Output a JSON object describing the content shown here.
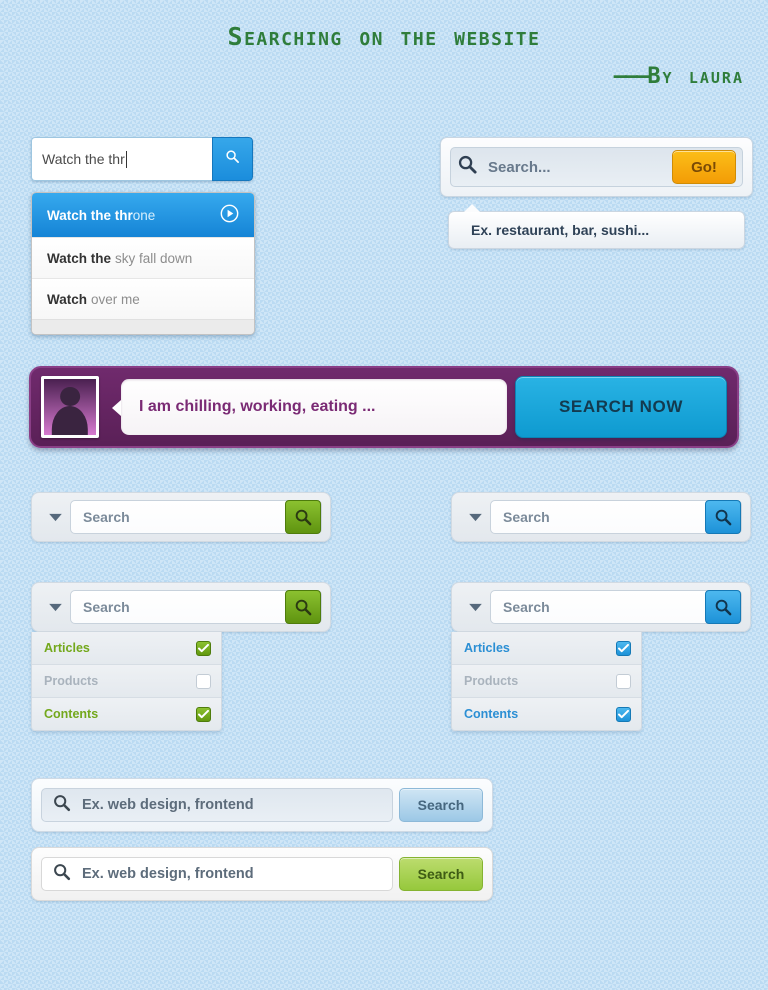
{
  "header": {
    "title": "Searching on the website",
    "byline_dash": "———",
    "byline": "By laura",
    "title_color": "#2f7d3b"
  },
  "autocomplete": {
    "input_value": "Watch the thr",
    "search_icon": "magnifier-icon",
    "suggestions": [
      {
        "bold": "Watch the thr",
        "rest": "one",
        "active": true,
        "icon": "play-circle-icon"
      },
      {
        "bold": "Watch the",
        "rest": "sky fall down",
        "active": false
      },
      {
        "bold": "Watch",
        "rest": "over me",
        "active": false
      }
    ]
  },
  "gray_search": {
    "placeholder": "Search...",
    "search_icon": "magnifier-icon",
    "button_label": "Go!",
    "button_color": "#f6a408",
    "tooltip": "Ex. restaurant, bar, sushi..."
  },
  "purple_bar": {
    "avatar": "user-avatar",
    "input_value": "I am chilling, working, eating ...",
    "button_label": "SEARCH NOW",
    "bar_color": "#5f2259",
    "button_color": "#13a0d4"
  },
  "dropdown_searches": [
    {
      "id": "green-collapsed",
      "caret_icon": "chevron-down-icon",
      "placeholder": "Search",
      "button_icon": "magnifier-icon",
      "accent": "#6f9f14",
      "expanded": false,
      "options": []
    },
    {
      "id": "blue-collapsed",
      "caret_icon": "chevron-down-icon",
      "placeholder": "Search",
      "button_icon": "magnifier-icon",
      "accent": "#1d92d8",
      "expanded": false,
      "options": []
    },
    {
      "id": "green-expanded",
      "caret_icon": "chevron-down-icon",
      "placeholder": "Search",
      "button_icon": "magnifier-icon",
      "accent": "#6f9f14",
      "expanded": true,
      "options": [
        {
          "label": "Articles",
          "checked": true
        },
        {
          "label": "Products",
          "checked": false
        },
        {
          "label": "Contents",
          "checked": true
        }
      ]
    },
    {
      "id": "blue-expanded",
      "caret_icon": "chevron-down-icon",
      "placeholder": "Search",
      "button_icon": "magnifier-icon",
      "accent": "#1d92d8",
      "expanded": true,
      "options": [
        {
          "label": "Articles",
          "checked": true
        },
        {
          "label": "Products",
          "checked": false
        },
        {
          "label": "Contents",
          "checked": true
        }
      ]
    }
  ],
  "bottom_bars": [
    {
      "id": "bar-blue",
      "search_icon": "magnifier-icon",
      "placeholder": "Ex. web design, frontend",
      "button_label": "Search",
      "button_color": "#9cc8e6"
    },
    {
      "id": "bar-green",
      "search_icon": "magnifier-icon",
      "placeholder": "Ex. web design, frontend",
      "button_label": "Search",
      "button_color": "#96c83c"
    }
  ]
}
